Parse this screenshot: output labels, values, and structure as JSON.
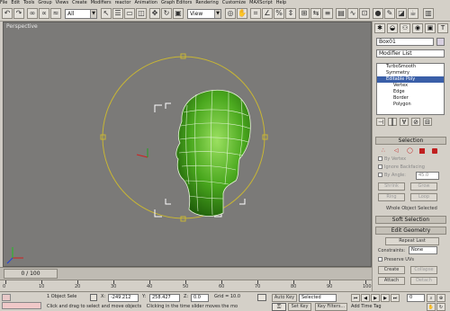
{
  "menu": [
    "File",
    "Edit",
    "Tools",
    "Group",
    "Views",
    "Create",
    "Modifiers",
    "reactor",
    "Animation",
    "Graph Editors",
    "Rendering",
    "Customize",
    "MAXScript",
    "Help"
  ],
  "toolbar": {
    "selection_filter": "All",
    "view_dropdown": "View"
  },
  "viewport": {
    "label": "Perspective"
  },
  "command_panel": {
    "object_name": "Box01",
    "modifier_list": "Modifier List",
    "stack": [
      "TurboSmooth",
      "Symmetry",
      "Editable Poly",
      "Vertex",
      "Edge",
      "Border",
      "Polygon"
    ],
    "selection_rollout": "Selection",
    "by_vertex": "By Vertex",
    "ignore_backfacing": "Ignore Backfacing",
    "by_angle": "By Angle:",
    "by_angle_value": "45.0",
    "shrink": "Shrink",
    "grow": "Grow",
    "ring": "Ring",
    "loop": "Loop",
    "whole_object_selected": "Whole Object Selected",
    "soft_selection_rollout": "Soft Selection",
    "edit_geometry_rollout": "Edit Geometry",
    "repeat_last": "Repeat Last",
    "constraints_label": "Constraints:",
    "constraints_value": "None",
    "preserve_uvs": "Preserve UVs",
    "create": "Create",
    "collapse": "Collapse",
    "attach": "Attach",
    "detach": "Detach"
  },
  "timeline": {
    "slider": "0 / 100",
    "ticks": [
      "0",
      "10",
      "20",
      "30",
      "40",
      "50",
      "60",
      "70",
      "80",
      "90",
      "100"
    ]
  },
  "status": {
    "selected_count": "1 Object Sele",
    "x_label": "X:",
    "x_value": "-249.212",
    "y_label": "Y:",
    "y_value": "258.427",
    "z_label": "Z:",
    "z_value": "0.0",
    "grid": "Grid = 10.0",
    "prompt": "Click and drag to select and move objects",
    "prompt_more": "Clicking in the time slider moves the mo",
    "auto_key": "Auto Key",
    "auto_key_value": "Selected",
    "set_key": "Set Key",
    "key_filters": "Key Filters...",
    "add_time_tag": "Add Time Tag",
    "frame_value": "0"
  }
}
